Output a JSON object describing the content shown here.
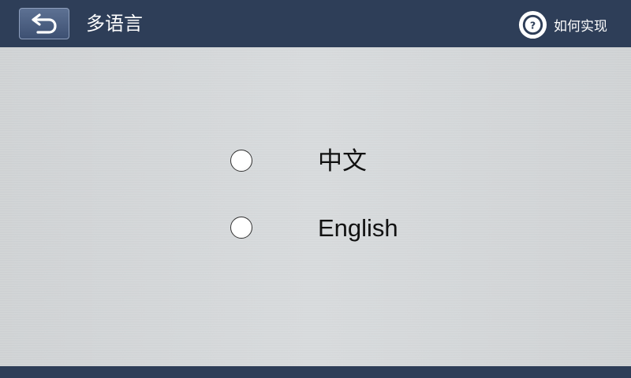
{
  "header": {
    "title": "多语言",
    "back_icon": "back-arrow-icon",
    "help_label": "如何实现",
    "help_icon": "help-circle-icon",
    "help_icon_glyph": "?"
  },
  "languages": [
    {
      "label": "中文",
      "selected": false
    },
    {
      "label": "English",
      "selected": false
    }
  ],
  "colors": {
    "header_bg": "#2e3e58",
    "content_bg": "#d2d5d7",
    "text_light": "#ffffff",
    "text_dark": "#111111"
  }
}
